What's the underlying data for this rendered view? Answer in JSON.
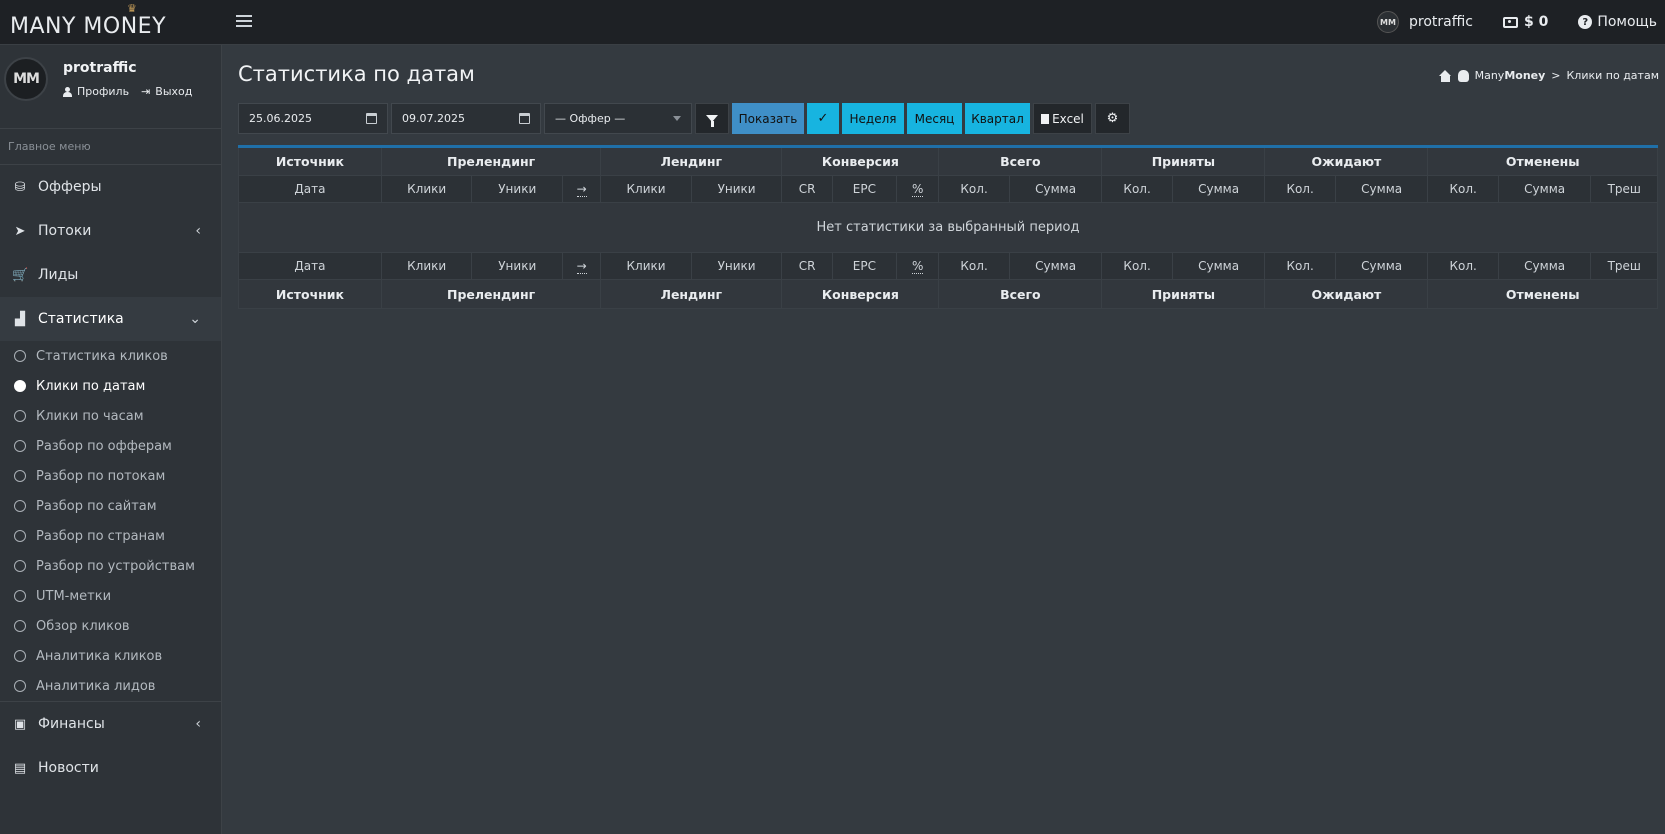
{
  "brand": {
    "name": "MANY MONEY"
  },
  "topnav": {
    "username": "protraffic",
    "avatar_text": "MM",
    "balance": "$ 0",
    "help": "Помощь"
  },
  "sidebar": {
    "user_name": "protraffic",
    "avatar_text": "MM",
    "profile": "Профиль",
    "logout": "Выход",
    "menu_header": "Главное меню",
    "items": {
      "offers": "Офферы",
      "streams": "Потоки",
      "leads": "Лиды",
      "stats": "Статистика",
      "finance": "Финансы",
      "news": "Новости"
    },
    "stats_sub": [
      "Статистика кликов",
      "Клики по датам",
      "Клики по часам",
      "Разбор по офферам",
      "Разбор по потокам",
      "Разбор по сайтам",
      "Разбор по странам",
      "Разбор по устройствам",
      "UTM-метки",
      "Обзор кликов",
      "Аналитика кликов",
      "Аналитика лидов"
    ]
  },
  "page": {
    "title": "Статистика по датам",
    "breadcrumb": {
      "brand_light": "Many",
      "brand_bold": "Money",
      "sep": ">",
      "current": "Клики по датам"
    }
  },
  "toolbar": {
    "date_from": "25.06.2025",
    "date_to": "09.07.2025",
    "offer_placeholder": "— Оффер —",
    "show": "Показать",
    "week": "Неделя",
    "month": "Месяц",
    "quarter": "Квартал",
    "excel": "Excel"
  },
  "table": {
    "groups": [
      "Источник",
      "Прелендинг",
      "Лендинг",
      "Конверсия",
      "Всего",
      "Приняты",
      "Ожидают",
      "Отменены"
    ],
    "columns": [
      "Дата",
      "Клики",
      "Уники",
      "→",
      "Клики",
      "Уники",
      "CR",
      "EPC",
      "%",
      "Кол.",
      "Сумма",
      "Кол.",
      "Сумма",
      "Кол.",
      "Сумма",
      "Кол.",
      "Сумма",
      "Треш"
    ],
    "empty_message": "Нет статистики за выбранный период"
  },
  "colors": {
    "primary_button": "#3f8fc7",
    "info_button": "#17b4e0",
    "table_accent": "#1f6fa8"
  }
}
